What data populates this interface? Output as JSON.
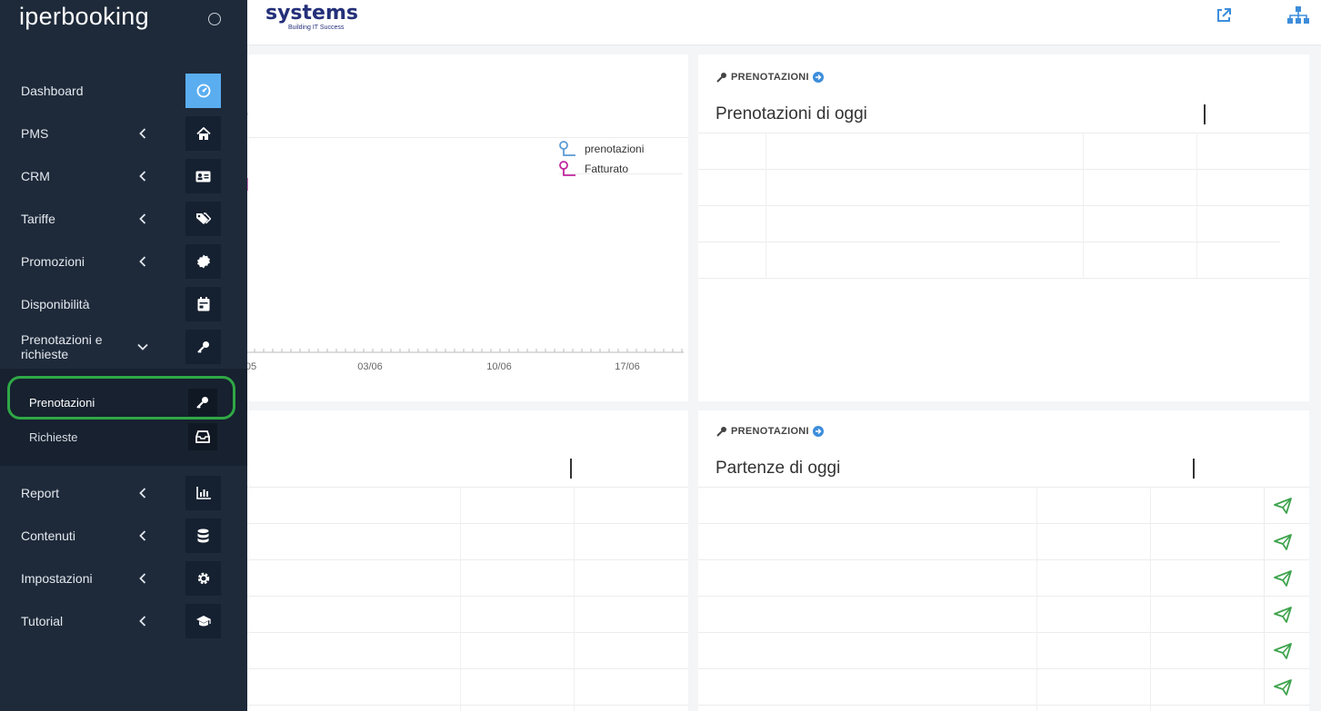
{
  "header": {
    "brand_partial": "g",
    "logo_text": "systems",
    "logo_tagline": "Building IT Success",
    "icons": [
      "external-link-icon",
      "sitemap-icon"
    ]
  },
  "sidebar": {
    "brand": "iperbooking",
    "items": [
      {
        "label": "Dashboard",
        "icon": "dashboard-icon",
        "chevron": false,
        "active": true
      },
      {
        "label": "PMS",
        "icon": "home-icon",
        "chevron": true
      },
      {
        "label": "CRM",
        "icon": "id-card-icon",
        "chevron": true
      },
      {
        "label": "Tariffe",
        "icon": "tags-icon",
        "chevron": true
      },
      {
        "label": "Promozioni",
        "icon": "certificate-icon",
        "chevron": true
      },
      {
        "label": "Disponibilità",
        "icon": "calendar-icon",
        "chevron": false
      },
      {
        "label": "Prenotazioni e richieste",
        "icon": "key-icon",
        "chevron": true,
        "expanded": true
      },
      {
        "label": "Report",
        "icon": "bar-chart-icon",
        "chevron": true
      },
      {
        "label": "Contenuti",
        "icon": "database-icon",
        "chevron": true
      },
      {
        "label": "Impostazioni",
        "icon": "gear-icon",
        "chevron": true
      },
      {
        "label": "Tutorial",
        "icon": "graduation-cap-icon",
        "chevron": true
      }
    ],
    "subitems": [
      {
        "label": "Prenotazioni",
        "icon": "key-icon",
        "highlighted": true
      },
      {
        "label": "Richieste",
        "icon": "inbox-icon"
      }
    ]
  },
  "chart_panel": {
    "legend": [
      {
        "label": "prenotazioni",
        "color": "#5b9bd5"
      },
      {
        "label": "Fatturato",
        "color": "#c0249e"
      }
    ],
    "x_ticks": [
      "05",
      "03/06",
      "10/06",
      "17/06"
    ]
  },
  "chart_data": {
    "type": "line",
    "x": [
      "05",
      "03/06",
      "10/06",
      "17/06"
    ],
    "series": [
      {
        "name": "prenotazioni",
        "color": "#5b9bd5"
      },
      {
        "name": "Fatturato",
        "color": "#c0249e"
      }
    ]
  },
  "panels": {
    "today_bookings": {
      "tag": "PRENOTAZIONI",
      "title": "Prenotazioni di oggi"
    },
    "departures": {
      "tag": "PRENOTAZIONI",
      "title": "Partenze di oggi",
      "send_icon_count": 6
    }
  },
  "colors": {
    "sidebar_bg": "#1e2a3a",
    "active_icon": "#5aaef0",
    "highlight_border": "#2fa846",
    "send_icon": "#3fa34d",
    "logo": "#24307a"
  }
}
